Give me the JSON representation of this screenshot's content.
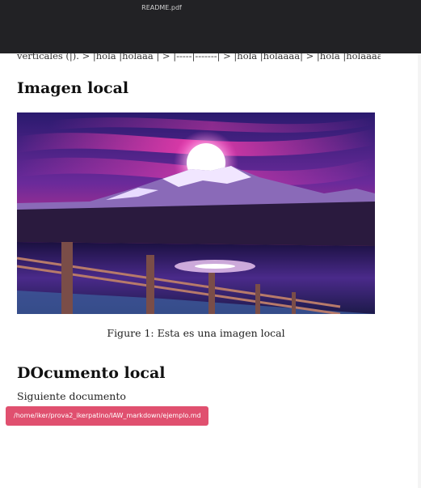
{
  "window": {
    "title": "README.pdf"
  },
  "document": {
    "cut_line": "verticales (|). > |hola |holaaa | > |-----|-------| > |hola |holaaaa| > |hola |holaaaa|",
    "section_image_heading": "Imagen local",
    "figure_caption": "Figure 1: Esta es una imagen local",
    "section_doc_heading": "DOcumento local",
    "paragraph": "Siguiente documento"
  },
  "link_tooltip": {
    "path": "/home/iker/prova2_ikerpatino/IAW_markdown/ejemplo.md"
  },
  "colors": {
    "toolbar_bg": "#222225",
    "tooltip_bg": "#e0506f"
  }
}
